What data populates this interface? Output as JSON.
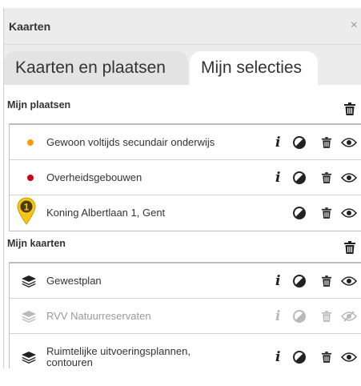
{
  "panel": {
    "title": "Kaarten",
    "close_symbol": "×"
  },
  "tabs": [
    {
      "label": "Kaarten en plaatsen",
      "active": false
    },
    {
      "label": "Mijn selecties",
      "active": true
    }
  ],
  "places": {
    "heading": "Mijn plaatsen",
    "items": [
      {
        "label": "Gewoon voltijds secundair onderwijs",
        "marker": "dot",
        "color": "#f39c12"
      },
      {
        "label": "Overheidsgebouwen",
        "marker": "dot",
        "color": "#d0021b"
      },
      {
        "label": "Koning Albertlaan 1, Gent",
        "marker": "pin",
        "pin_number": "1",
        "color": "#f5c518"
      }
    ]
  },
  "maps": {
    "heading": "Mijn kaarten",
    "items": [
      {
        "label": "Gewestplan",
        "enabled": true
      },
      {
        "label": "RVV Natuurreservaten",
        "enabled": false
      },
      {
        "label": "Ruimtelijke uitvoeringsplannen, contouren",
        "enabled": true
      }
    ]
  },
  "actions": {
    "info_symbol": "i"
  },
  "colors": {
    "icon": "#222222",
    "disabled": "#b9b9b9",
    "header_bg": "#ececec"
  }
}
